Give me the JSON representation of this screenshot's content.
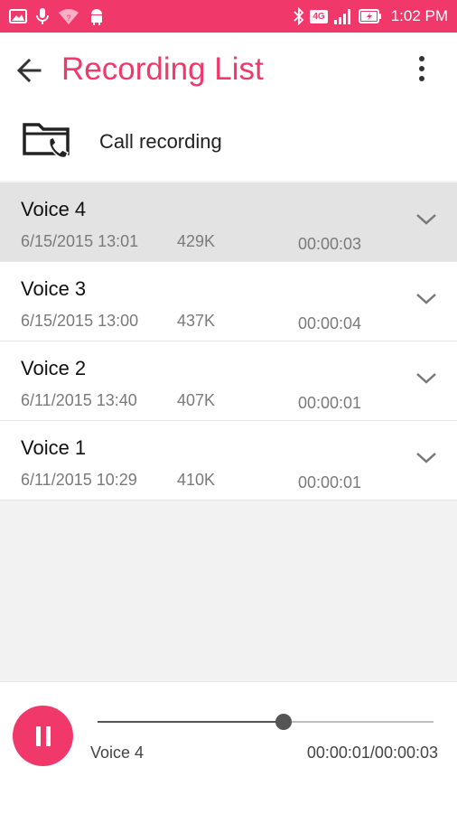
{
  "status_bar": {
    "time": "1:02 PM",
    "network": "4G",
    "icons": [
      "image-icon",
      "mic-icon",
      "wifi-question-icon",
      "android-icon",
      "bluetooth-icon",
      "signal-icon",
      "battery-charging-icon"
    ],
    "background_color": "#f0386b"
  },
  "app_bar": {
    "title": "Recording List",
    "accent_color": "#f0386b",
    "icons": [
      "back-arrow-icon",
      "overflow-menu-icon"
    ]
  },
  "call_recording": {
    "label": "Call recording",
    "icon": "folder-phone-icon"
  },
  "recordings": [
    {
      "name": "Voice 4",
      "date": "6/15/2015 13:01",
      "size": "429K",
      "duration": "00:00:03",
      "selected": true
    },
    {
      "name": "Voice 3",
      "date": "6/15/2015 13:00",
      "size": "437K",
      "duration": "00:00:04",
      "selected": false
    },
    {
      "name": "Voice 2",
      "date": "6/11/2015 13:40",
      "size": "407K",
      "duration": "00:00:01",
      "selected": false
    },
    {
      "name": "Voice 1",
      "date": "6/11/2015 10:29",
      "size": "410K",
      "duration": "00:00:01",
      "selected": false
    }
  ],
  "player": {
    "now_playing": "Voice 4",
    "time_display": "00:00:01/00:00:03",
    "progress_fraction": 0.555,
    "state": "playing",
    "button_icon": "pause-icon"
  }
}
